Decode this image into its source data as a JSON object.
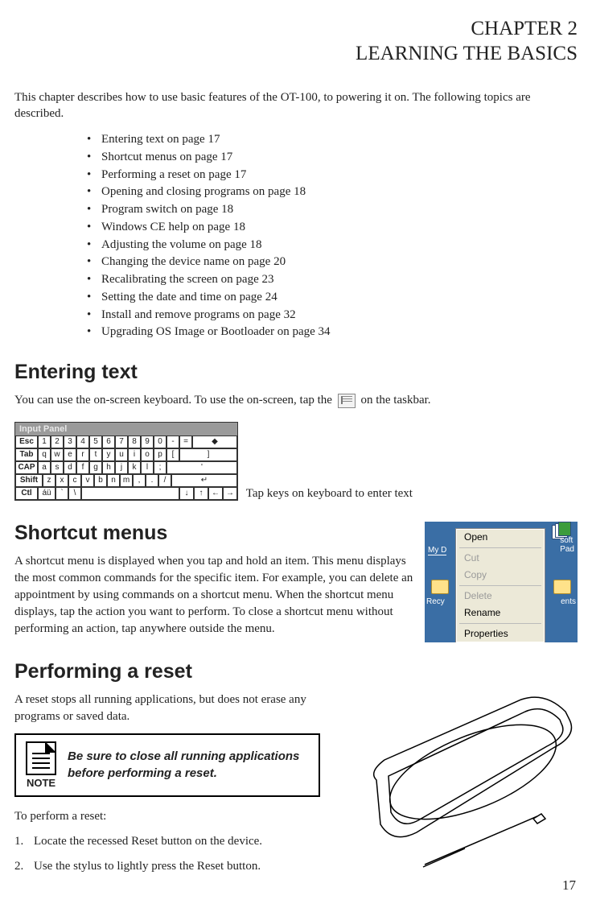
{
  "chapter": {
    "line1": "CHAPTER 2",
    "line2": "LEARNING THE BASICS"
  },
  "intro": "This chapter describes how to use basic features of the OT-100, to powering it on. The following topics are described.",
  "topics": [
    "Entering text on page 17",
    "Shortcut menus on page 17",
    "Performing a reset on page 17",
    "Opening and closing programs on page 18",
    "Program switch on page 18",
    "Windows CE help on page 18",
    "Adjusting the volume on page 18",
    "Changing the device name on page 20",
    "Recalibrating the screen on page 23",
    "Setting the date and time on page 24",
    "Install and remove programs on page 32",
    "Upgrading OS Image or Bootloader on page 34"
  ],
  "entering": {
    "heading": "Entering text",
    "p_before": "You can use the on-screen keyboard. To use the on-screen, tap the",
    "p_after": "on the taskbar.",
    "panel_title": "Input Panel",
    "rows": {
      "r1": [
        "Esc",
        "1",
        "2",
        "3",
        "4",
        "5",
        "6",
        "7",
        "8",
        "9",
        "0",
        "-",
        "=",
        "◆"
      ],
      "r2": [
        "Tab",
        "q",
        "w",
        "e",
        "r",
        "t",
        "y",
        "u",
        "i",
        "o",
        "p",
        "[",
        "]"
      ],
      "r3": [
        "CAP",
        "a",
        "s",
        "d",
        "f",
        "g",
        "h",
        "j",
        "k",
        "l",
        ";",
        "'"
      ],
      "r4": [
        "Shift",
        "z",
        "x",
        "c",
        "v",
        "b",
        "n",
        "m",
        ",",
        ".",
        "/",
        "↵"
      ],
      "r5": [
        "Ctl",
        "áü",
        "`",
        "\\",
        " ",
        "↓",
        "↑",
        "←",
        "→"
      ]
    },
    "caption": "Tap keys on keyboard to enter text"
  },
  "shortcut": {
    "heading": "Shortcut menus",
    "body": "A shortcut menu is displayed when you tap and hold an item. This menu displays the most common commands for the specific item. For example, you can delete an appointment by using commands on a shortcut menu. When the shortcut menu displays, tap the action you want to perform. To close a shortcut menu without performing an action, tap anywhere outside the menu.",
    "menu": {
      "open": "Open",
      "cut": "Cut",
      "copy": "Copy",
      "delete": "Delete",
      "rename": "Rename",
      "properties": "Properties"
    },
    "desk": {
      "myd": "My D",
      "soft": "soft",
      "pad": "Pad",
      "recy": "Recy",
      "ents": "ents"
    }
  },
  "reset": {
    "heading": "Performing a reset",
    "body": "A reset stops all running applications, but does not erase any programs or saved data.",
    "note_label": "NOTE",
    "note_text": "Be sure to close all running applications before performing a reset.",
    "lead": "To perform a reset:",
    "steps": [
      "Locate the recessed Reset button on the device.",
      "Use the stylus to lightly press the Reset button."
    ]
  },
  "page_number": "17"
}
